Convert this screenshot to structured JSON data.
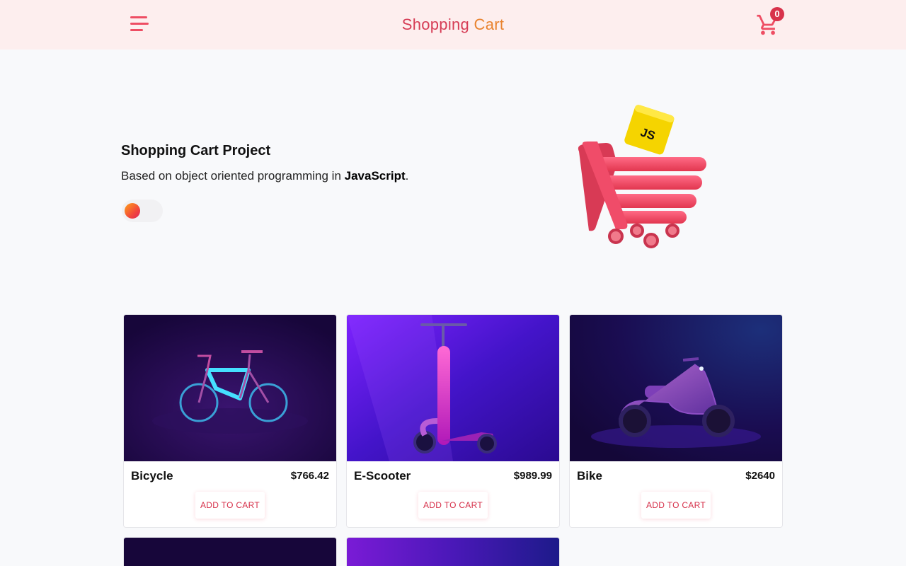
{
  "header": {
    "title_part1": "Shopping",
    "title_part2": "Cart",
    "cart_count": "0",
    "menu_icon": "hamburger-menu-icon",
    "cart_icon": "shopping-cart-icon"
  },
  "hero": {
    "title": "Shopping Cart Project",
    "subtitle_prefix": "Based on object oriented programming in ",
    "subtitle_emphasis": "JavaScript",
    "subtitle_suffix": ".",
    "image_badge": "JS"
  },
  "products": [
    {
      "name": "Bicycle",
      "price": "$766.42",
      "button": "ADD TO CART"
    },
    {
      "name": "E-Scooter",
      "price": "$989.99",
      "button": "ADD TO CART"
    },
    {
      "name": "Bike",
      "price": "$2640",
      "button": "ADD TO CART"
    }
  ],
  "colors": {
    "accent": "#ee4d63",
    "brand_red": "#d63c55",
    "brand_orange": "#e9832f",
    "header_bg": "#fdeeee"
  }
}
